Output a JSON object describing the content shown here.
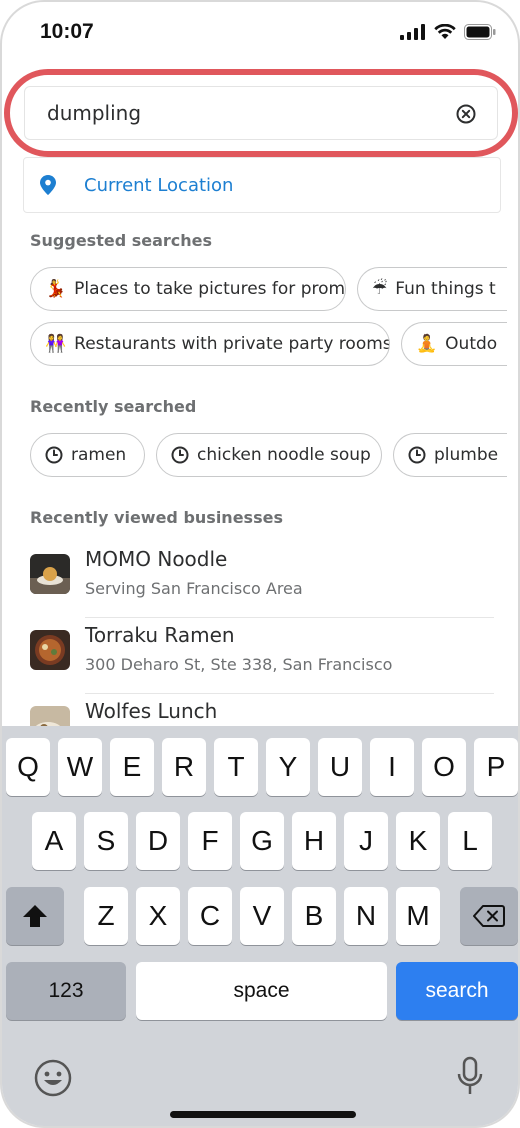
{
  "status_bar": {
    "time": "10:07"
  },
  "search": {
    "value": "dumpling",
    "highlight_color": "#e0575c"
  },
  "current_location": {
    "label": "Current Location",
    "color": "#1d7fd1"
  },
  "suggested": {
    "title": "Suggested searches",
    "row1": [
      {
        "emoji": "💃",
        "label": "Places to take pictures for prom"
      },
      {
        "emoji": "☔",
        "label": "Fun things t"
      }
    ],
    "row2": [
      {
        "emoji": "👭",
        "label": "Restaurants with private party rooms"
      },
      {
        "emoji": "🧘",
        "label": "Outdo"
      }
    ]
  },
  "recent_searches": {
    "title": "Recently searched",
    "items": [
      "ramen",
      "chicken noodle soup",
      "plumbe"
    ]
  },
  "recent_businesses": {
    "title": "Recently viewed businesses",
    "items": [
      {
        "name": "MOMO Noodle",
        "address": "Serving San Francisco Area"
      },
      {
        "name": "Torraku Ramen",
        "address": "300 Deharo St, Ste 338, San Francisco"
      },
      {
        "name": "Wolfes Lunch",
        "address": ""
      }
    ]
  },
  "keyboard": {
    "row1": [
      "Q",
      "W",
      "E",
      "R",
      "T",
      "Y",
      "U",
      "I",
      "O",
      "P"
    ],
    "row2": [
      "A",
      "S",
      "D",
      "F",
      "G",
      "H",
      "J",
      "K",
      "L"
    ],
    "row3": [
      "Z",
      "X",
      "C",
      "V",
      "B",
      "N",
      "M"
    ],
    "numbers_label": "123",
    "space_label": "space",
    "search_label": "search",
    "accent": "#2d7ff0"
  }
}
